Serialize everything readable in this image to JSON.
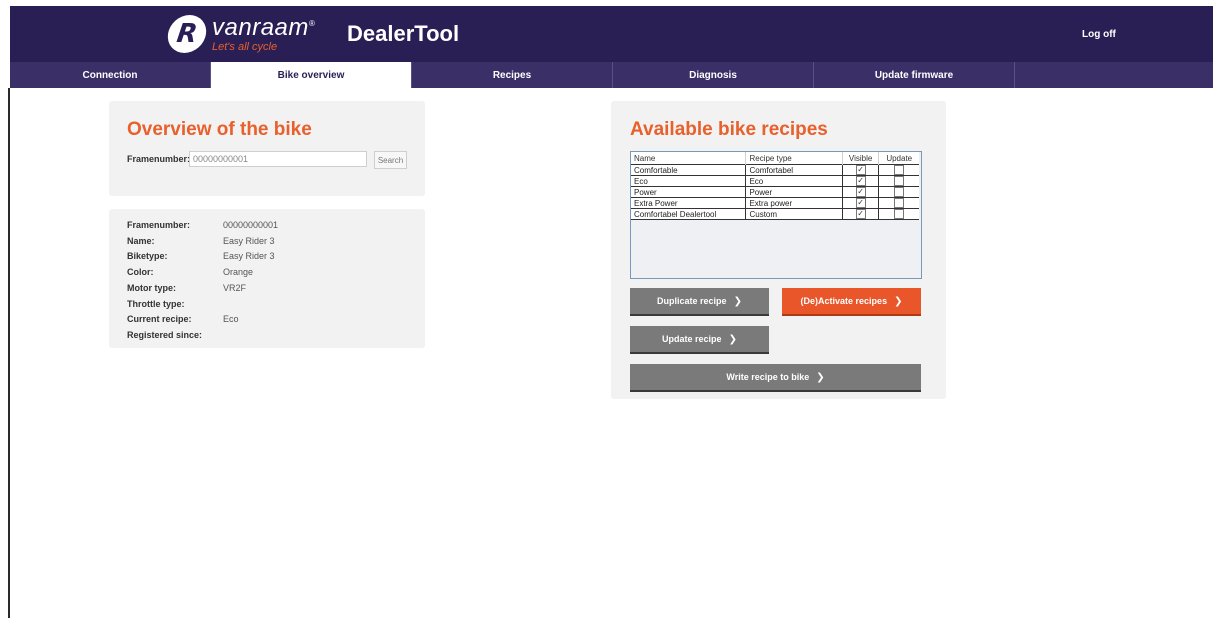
{
  "header": {
    "logo_brand": "vanraam",
    "logo_tagline": "Let's all cycle",
    "logo_mark": "R",
    "app_title": "DealerTool",
    "logoff_label": "Log off"
  },
  "nav": {
    "tabs": [
      {
        "label": "Connection"
      },
      {
        "label": "Bike overview"
      },
      {
        "label": "Recipes"
      },
      {
        "label": "Diagnosis"
      },
      {
        "label": "Update firmware"
      }
    ],
    "active": "Bike overview"
  },
  "overview": {
    "title": "Overview of the bike",
    "framenumber_label": "Framenumber:",
    "framenumber_value": "00000000001",
    "search_label": "Search"
  },
  "bike_info": {
    "rows": [
      {
        "label": "Framenumber:",
        "value": "00000000001"
      },
      {
        "label": "Name:",
        "value": "Easy Rider 3"
      },
      {
        "label": "Biketype:",
        "value": "Easy Rider 3"
      },
      {
        "label": "Color:",
        "value": "Orange"
      },
      {
        "label": "Motor type:",
        "value": "VR2F"
      },
      {
        "label": "Throttle type:",
        "value": ""
      },
      {
        "label": "Current recipe:",
        "value": "Eco"
      },
      {
        "label": "Registered since:",
        "value": ""
      }
    ]
  },
  "recipes": {
    "title": "Available bike recipes",
    "columns": {
      "name": "Name",
      "type": "Recipe type",
      "visible": "Visible",
      "update": "Update"
    },
    "rows": [
      {
        "name": "Comfortable",
        "type": "Comfortabel",
        "visible": true,
        "update": false
      },
      {
        "name": "Eco",
        "type": "Eco",
        "visible": true,
        "update": false
      },
      {
        "name": "Power",
        "type": "Power",
        "visible": true,
        "update": false
      },
      {
        "name": "Extra Power",
        "type": "Extra power",
        "visible": true,
        "update": false
      },
      {
        "name": "Comfortabel Dealertool",
        "type": "Custom",
        "visible": true,
        "update": false
      }
    ],
    "buttons": {
      "duplicate": "Duplicate recipe",
      "activate": "(De)Activate recipes",
      "update": "Update recipe",
      "write": "Write recipe to bike"
    }
  },
  "colors": {
    "header_bg": "#2a1f55",
    "nav_bg": "#3a2f66",
    "accent": "#e8602c",
    "button_gray": "#7a7a7a",
    "button_orange": "#e8562a"
  }
}
